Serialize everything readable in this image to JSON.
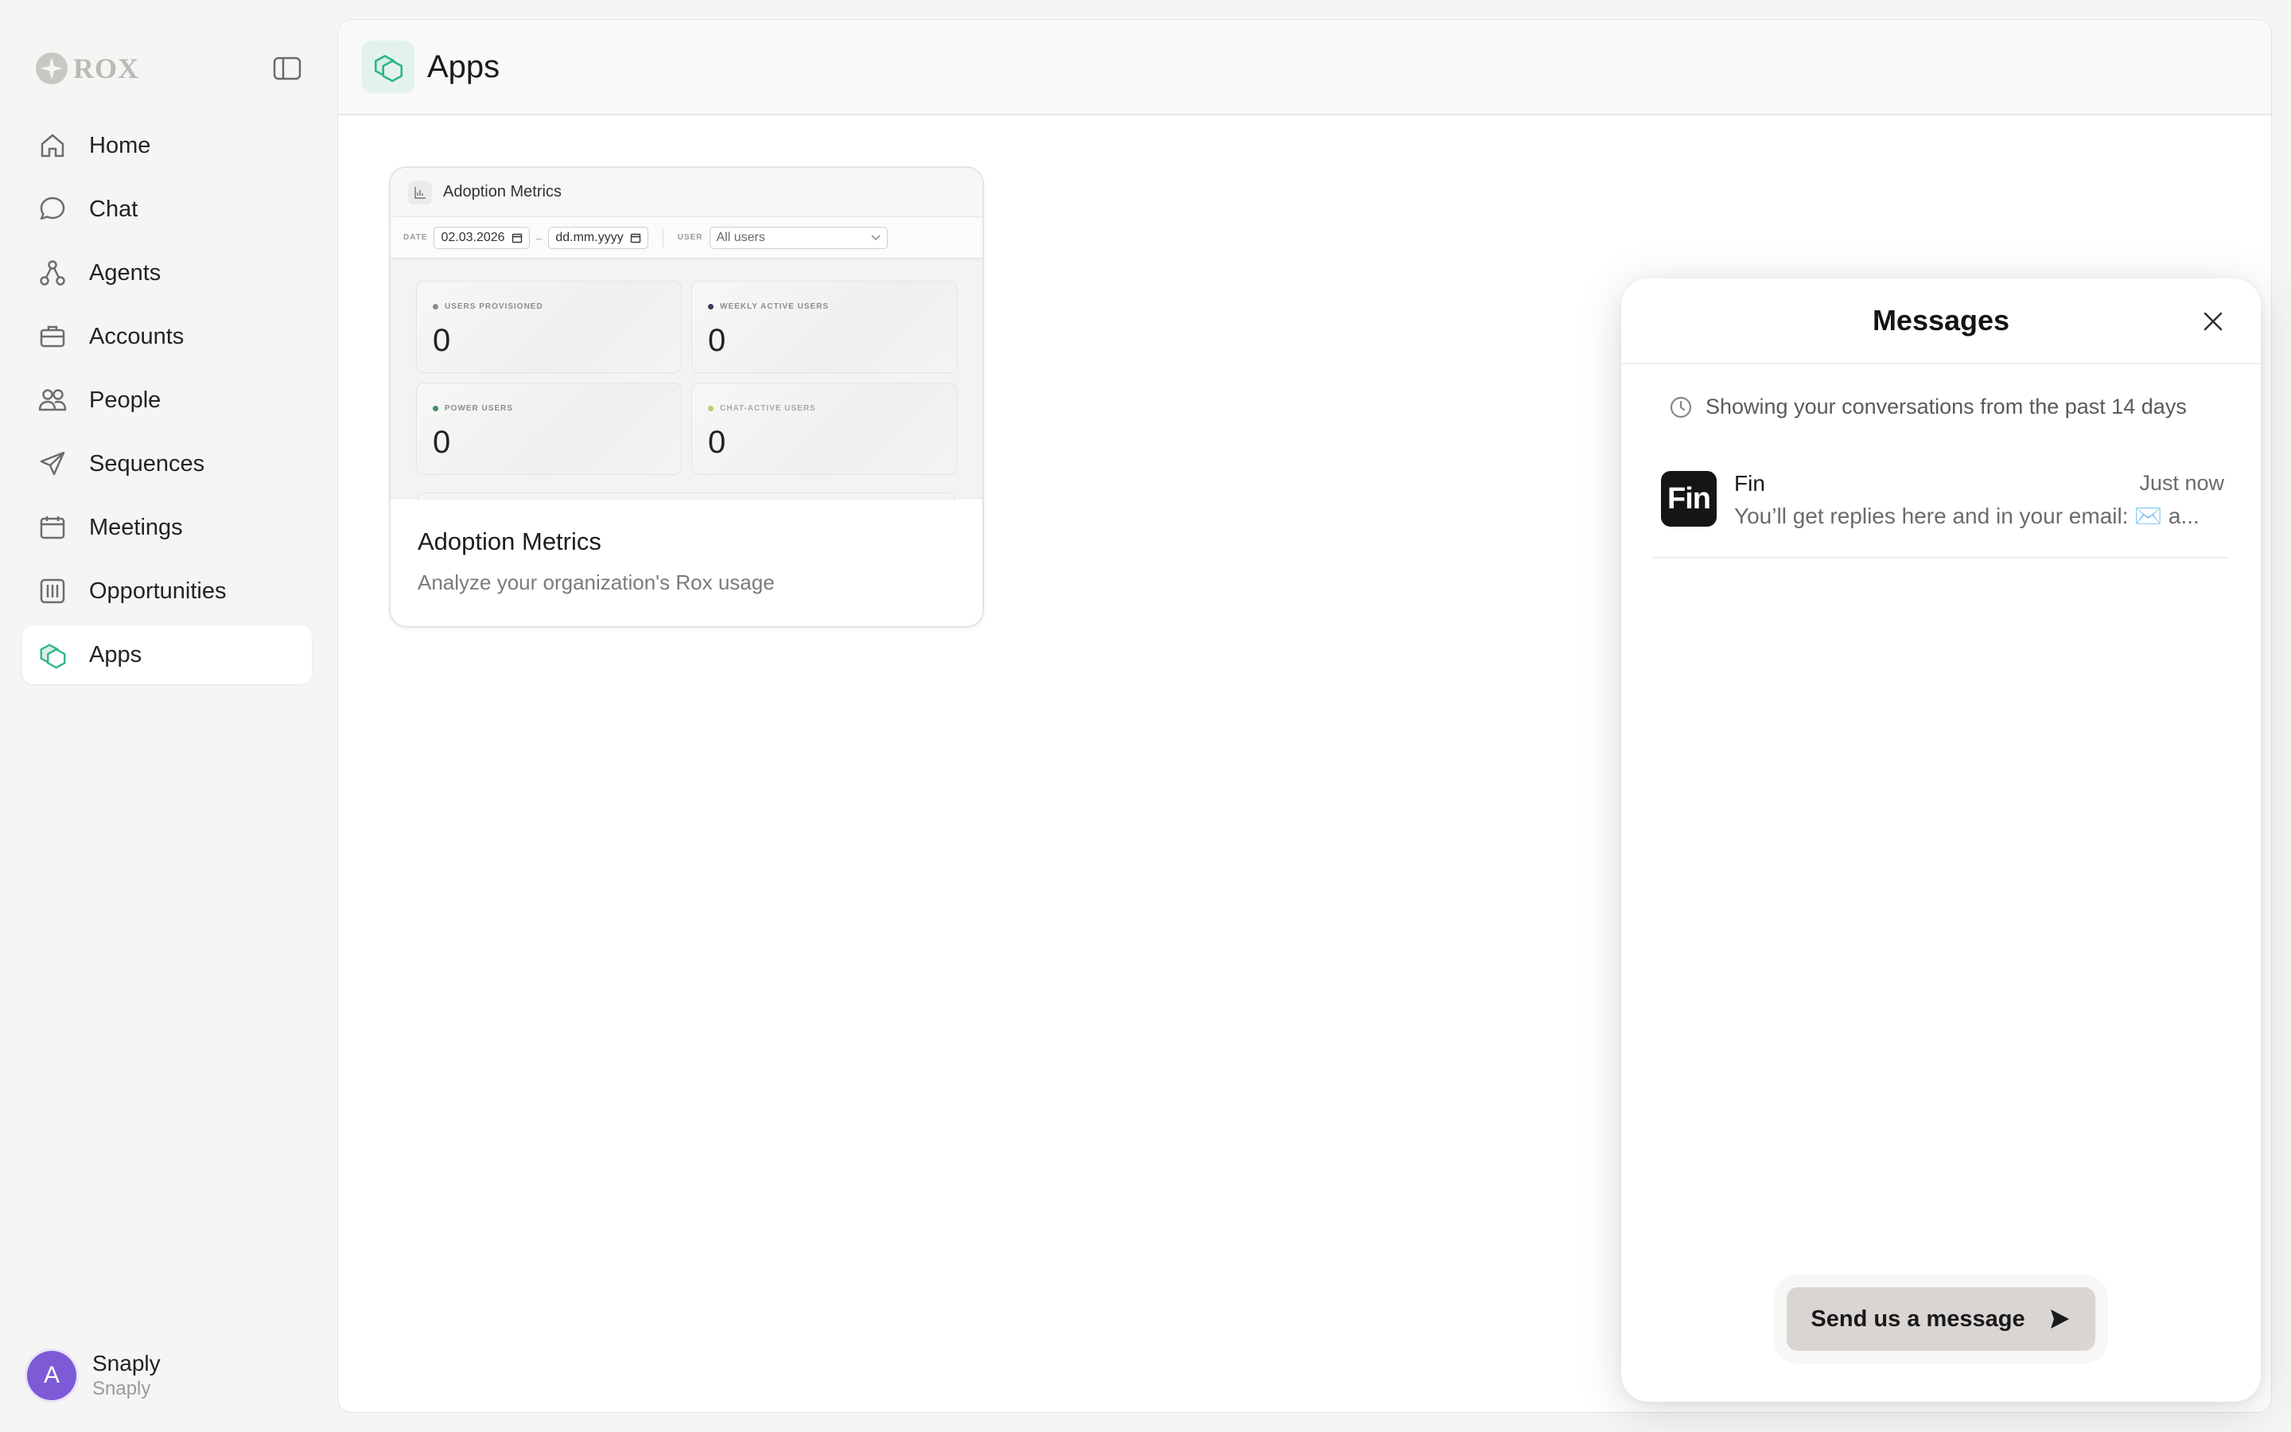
{
  "brand": {
    "name": "ROX"
  },
  "sidebar": {
    "items": [
      {
        "label": "Home",
        "icon": "home-icon"
      },
      {
        "label": "Chat",
        "icon": "chat-bubble-icon"
      },
      {
        "label": "Agents",
        "icon": "agents-icon"
      },
      {
        "label": "Accounts",
        "icon": "briefcase-icon"
      },
      {
        "label": "People",
        "icon": "people-icon"
      },
      {
        "label": "Sequences",
        "icon": "paper-plane-icon"
      },
      {
        "label": "Meetings",
        "icon": "calendar-icon"
      },
      {
        "label": "Opportunities",
        "icon": "columns-icon"
      },
      {
        "label": "Apps",
        "icon": "apps-icon",
        "active": true
      }
    ]
  },
  "user": {
    "initial": "A",
    "name": "Snaply",
    "org": "Snaply"
  },
  "header": {
    "title": "Apps"
  },
  "app_card": {
    "title": "Adoption Metrics",
    "description": "Analyze your organization's Rox usage",
    "preview": {
      "title": "Adoption Metrics",
      "date_label": "DATE",
      "date_from": "02.03.2026",
      "date_sep": "–",
      "date_to": "dd.mm.yyyy",
      "user_label": "USER",
      "user_select": "All users",
      "metrics": [
        {
          "label": "USERS PROVISIONED",
          "value": "0"
        },
        {
          "label": "WEEKLY ACTIVE USERS",
          "value": "0"
        },
        {
          "label": "POWER USERS",
          "value": "0"
        },
        {
          "label": "CHAT-ACTIVE USERS",
          "value": "0"
        }
      ]
    }
  },
  "messages": {
    "title": "Messages",
    "notice": "Showing your conversations from the past 14 days",
    "conversations": [
      {
        "logo": "Fin",
        "name": "Fin",
        "time": "Just now",
        "preview": "You’ll get replies here and in your email: ✉️ a..."
      }
    ],
    "send_label": "Send us a message"
  },
  "colors": {
    "accent": "#2fb58a",
    "avatar": "#7e5bd6",
    "background": "#f5f5f3"
  }
}
